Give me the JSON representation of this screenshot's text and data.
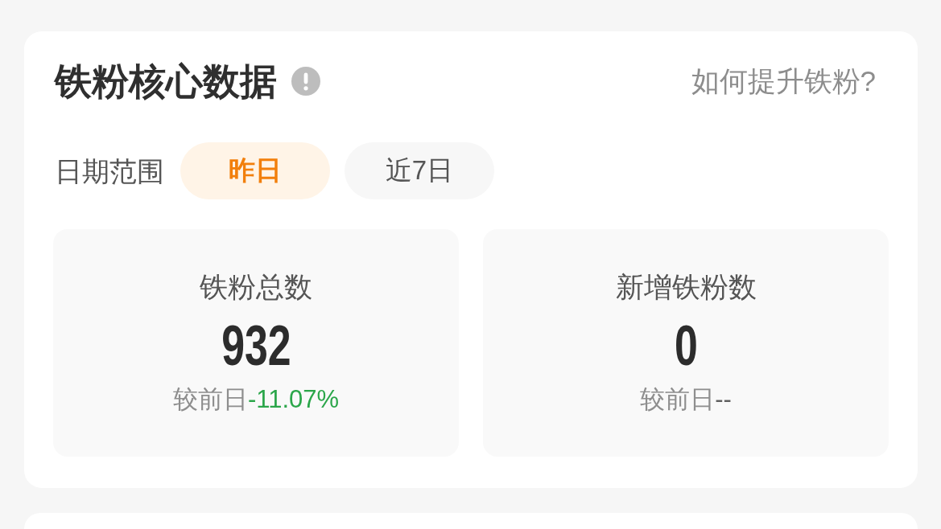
{
  "header": {
    "title": "铁粉核心数据",
    "help_link": "如何提升铁粉?"
  },
  "date_range": {
    "label": "日期范围",
    "tabs": [
      {
        "label": "昨日",
        "selected": true
      },
      {
        "label": "近7日",
        "selected": false
      }
    ]
  },
  "stats": [
    {
      "label": "铁粉总数",
      "value": "932",
      "compare_label": "较前日",
      "change": "-11.07%",
      "color": "#2ba64a"
    },
    {
      "label": "新增铁粉数",
      "value": "0",
      "compare_label": "较前日",
      "change": "--",
      "color": "#5f5f5f"
    }
  ]
}
